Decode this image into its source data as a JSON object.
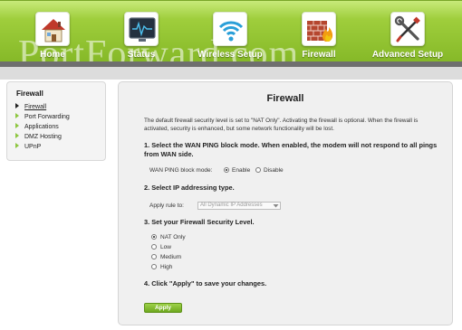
{
  "header": {
    "nav": [
      {
        "label": "Home",
        "icon": "home-icon"
      },
      {
        "label": "Status",
        "icon": "status-monitor-icon"
      },
      {
        "label": "Wireless Setup",
        "icon": "wireless-icon"
      },
      {
        "label": "Firewall",
        "icon": "firewall-icon"
      },
      {
        "label": "Advanced Setup",
        "icon": "tools-icon"
      }
    ],
    "watermark": "PortForward.com"
  },
  "sidebar": {
    "title": "Firewall",
    "items": [
      {
        "label": "Firewall",
        "active": true
      },
      {
        "label": "Port Forwarding",
        "active": false
      },
      {
        "label": "Applications",
        "active": false
      },
      {
        "label": "DMZ Hosting",
        "active": false
      },
      {
        "label": "UPnP",
        "active": false
      }
    ]
  },
  "main": {
    "title": "Firewall",
    "intro": "The default firewall security level is set to \"NAT Only\". Activating the firewall is optional. When the firewall is activated, security is enhanced, but some network functionality will be lost.",
    "step1": "1. Select the WAN PING block mode. When enabled, the modem will not respond to all pings from WAN side.",
    "wan_ping_label": "WAN PING block mode:",
    "wan_ping_options": [
      {
        "label": "Enable",
        "checked": true
      },
      {
        "label": "Disable",
        "checked": false
      }
    ],
    "step2": "2. Select IP addressing type.",
    "apply_rule_label": "Apply rule to:",
    "apply_rule_value": "All Dynamic IP Addresses",
    "step3": "3. Set your Firewall Security Level.",
    "security_levels": [
      {
        "label": "NAT Only",
        "checked": true
      },
      {
        "label": "Low",
        "checked": false
      },
      {
        "label": "Medium",
        "checked": false
      },
      {
        "label": "High",
        "checked": false
      }
    ],
    "step4": "4. Click \"Apply\" to save your changes.",
    "apply_label": "Apply"
  },
  "colors": {
    "accent": "#8dc63f",
    "nav_bar": "#9fce3c",
    "band_dark": "#6f6f6f",
    "panel": "#f0f0f0"
  }
}
